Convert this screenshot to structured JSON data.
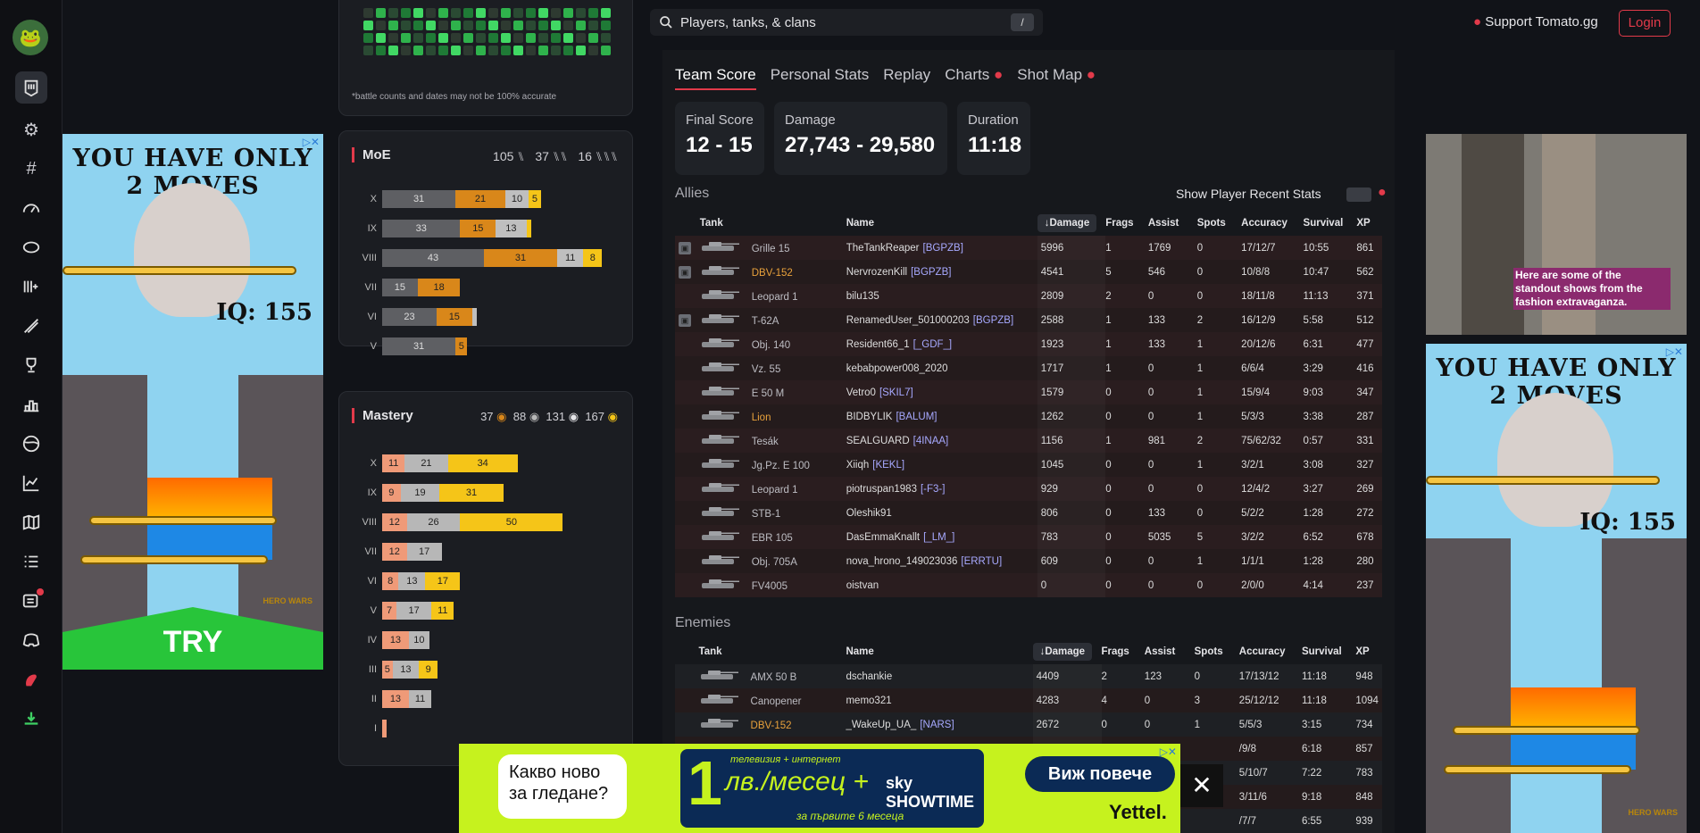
{
  "sidebar": {
    "icons": [
      "frog-logo-icon",
      "tank-nav-icon",
      "gear-icon",
      "hash-icon",
      "gauge-icon",
      "helmet-icon",
      "bars-plus-icon",
      "pen-icon",
      "trophy-icon",
      "podium-icon",
      "globe-icon",
      "line-chart-icon",
      "map-icon",
      "list-icon",
      "news-icon",
      "discord-icon",
      "tomato-icon",
      "download-icon"
    ]
  },
  "search": {
    "placeholder": "Players, tanks, & clans",
    "shortcut": "/"
  },
  "header": {
    "support_label": "Support Tomato.gg",
    "login_label": "Login"
  },
  "left_panel": {
    "footnote": "*battle counts and dates may not be 100% accurate",
    "moe": {
      "title": "MoE",
      "badges": [
        "105",
        "37",
        "16"
      ],
      "rows": [
        {
          "tier": "X",
          "values": [
            "31",
            "21",
            "10",
            "5"
          ]
        },
        {
          "tier": "IX",
          "values": [
            "33",
            "15",
            "13",
            ""
          ]
        },
        {
          "tier": "VIII",
          "values": [
            "43",
            "31",
            "11",
            "8"
          ]
        },
        {
          "tier": "VII",
          "values": [
            "15",
            "18"
          ]
        },
        {
          "tier": "VI",
          "values": [
            "23",
            "15",
            ""
          ]
        },
        {
          "tier": "V",
          "values": [
            "31",
            "5"
          ]
        }
      ]
    },
    "mastery": {
      "title": "Mastery",
      "badges": [
        "37",
        "88",
        "131",
        "167"
      ],
      "badge_icons": [
        "III",
        "II",
        "I",
        "M"
      ],
      "rows": [
        {
          "tier": "X",
          "values": [
            "11",
            "21",
            "34"
          ]
        },
        {
          "tier": "IX",
          "values": [
            "9",
            "19",
            "31"
          ]
        },
        {
          "tier": "VIII",
          "values": [
            "12",
            "26",
            "50"
          ]
        },
        {
          "tier": "VII",
          "values": [
            "12",
            "17"
          ]
        },
        {
          "tier": "VI",
          "values": [
            "8",
            "13",
            "17"
          ]
        },
        {
          "tier": "V",
          "values": [
            "7",
            "17",
            "11"
          ]
        },
        {
          "tier": "IV",
          "values": [
            "13",
            "10"
          ]
        },
        {
          "tier": "III",
          "values": [
            "5",
            "13",
            "9"
          ]
        },
        {
          "tier": "II",
          "values": [
            "13",
            "11"
          ]
        },
        {
          "tier": "I",
          "values": [
            ""
          ]
        }
      ]
    }
  },
  "tabs": [
    {
      "label": "Team Score",
      "active": true
    },
    {
      "label": "Personal Stats"
    },
    {
      "label": "Replay"
    },
    {
      "label": "Charts"
    },
    {
      "label": "Shot Map"
    }
  ],
  "summary": {
    "final_score_label": "Final Score",
    "final_score": "12 - 15",
    "damage_label": "Damage",
    "damage": "27,743 - 29,580",
    "duration_label": "Duration",
    "duration": "11:18"
  },
  "allies": {
    "title": "Allies",
    "show_recent_label": "Show Player Recent Stats",
    "columns": [
      "Tank",
      "Name",
      "Damage",
      "Frags",
      "Assist",
      "Spots",
      "Accuracy",
      "Survival",
      "XP"
    ],
    "rows": [
      {
        "platoon": true,
        "tank": "Grille 15",
        "name": "TheTankReaper",
        "clan": "[BGPZB]",
        "dmg": "5996",
        "frags": "1",
        "assist": "1769",
        "spots": "0",
        "acc": "17/12/7",
        "surv": "10:55",
        "xp": "861"
      },
      {
        "platoon": true,
        "tank": "DBV-152",
        "gold": true,
        "name": "NervrozenKill",
        "clan": "[BGPZB]",
        "dmg": "4541",
        "frags": "5",
        "assist": "546",
        "spots": "0",
        "acc": "10/8/8",
        "surv": "10:47",
        "xp": "562"
      },
      {
        "tank": "Leopard 1",
        "name": "bilu135",
        "clan": "",
        "dmg": "2809",
        "frags": "2",
        "assist": "0",
        "spots": "0",
        "acc": "18/11/8",
        "surv": "11:13",
        "xp": "371"
      },
      {
        "platoon": true,
        "tank": "T-62A",
        "name": "RenamedUser_501000203",
        "clan": "[BGPZB]",
        "dmg": "2588",
        "frags": "1",
        "assist": "133",
        "spots": "2",
        "acc": "16/12/9",
        "surv": "5:58",
        "xp": "512"
      },
      {
        "tank": "Obj. 140",
        "name": "Resident66_1",
        "clan": "[_GDF_]",
        "dmg": "1923",
        "frags": "1",
        "assist": "133",
        "spots": "1",
        "acc": "20/12/6",
        "surv": "6:31",
        "xp": "477"
      },
      {
        "tank": "Vz. 55",
        "name": "kebabpower008_2020",
        "clan": "",
        "dmg": "1717",
        "frags": "1",
        "assist": "0",
        "spots": "1",
        "acc": "6/6/4",
        "surv": "3:29",
        "xp": "416"
      },
      {
        "tank": "E 50 M",
        "name": "Vetro0",
        "clan": "[SKIL7]",
        "dmg": "1579",
        "frags": "0",
        "assist": "0",
        "spots": "1",
        "acc": "15/9/4",
        "surv": "9:03",
        "xp": "347"
      },
      {
        "tank": "Lion",
        "gold": true,
        "name": "BIDBYLIK",
        "clan": "[BALUM]",
        "dmg": "1262",
        "frags": "0",
        "assist": "0",
        "spots": "1",
        "acc": "5/3/3",
        "surv": "3:38",
        "xp": "287"
      },
      {
        "tank": "Tesák",
        "name": "SEALGUARD",
        "clan": "[4INAA]",
        "dmg": "1156",
        "frags": "1",
        "assist": "981",
        "spots": "2",
        "acc": "75/62/32",
        "surv": "0:57",
        "xp": "331"
      },
      {
        "tank": "Jg.Pz. E 100",
        "name": "Xiiqh",
        "clan": "[KEKL]",
        "dmg": "1045",
        "frags": "0",
        "assist": "0",
        "spots": "1",
        "acc": "3/2/1",
        "surv": "3:08",
        "xp": "327"
      },
      {
        "tank": "Leopard 1",
        "name": "piotruspan1983",
        "clan": "[-F3-]",
        "dmg": "929",
        "frags": "0",
        "assist": "0",
        "spots": "0",
        "acc": "12/4/2",
        "surv": "3:27",
        "xp": "269"
      },
      {
        "tank": "STB-1",
        "name": "Oleshik91",
        "clan": "",
        "dmg": "806",
        "frags": "0",
        "assist": "133",
        "spots": "0",
        "acc": "5/2/2",
        "surv": "1:28",
        "xp": "272"
      },
      {
        "tank": "EBR 105",
        "name": "DasEmmaKnallt",
        "clan": "[_LM_]",
        "dmg": "783",
        "frags": "0",
        "assist": "5035",
        "spots": "5",
        "acc": "3/2/2",
        "surv": "6:52",
        "xp": "678"
      },
      {
        "tank": "Obj. 705A",
        "name": "nova_hrono_149023036",
        "clan": "[ERRTU]",
        "dmg": "609",
        "frags": "0",
        "assist": "0",
        "spots": "1",
        "acc": "1/1/1",
        "surv": "1:28",
        "xp": "280"
      },
      {
        "tank": "FV4005",
        "name": "oistvan",
        "clan": "",
        "dmg": "0",
        "frags": "0",
        "assist": "0",
        "spots": "0",
        "acc": "2/0/0",
        "surv": "4:14",
        "xp": "237"
      }
    ]
  },
  "enemies": {
    "title": "Enemies",
    "columns": [
      "Tank",
      "Name",
      "Damage",
      "Frags",
      "Assist",
      "Spots",
      "Accuracy",
      "Survival",
      "XP"
    ],
    "rows": [
      {
        "tank": "AMX 50 B",
        "name": "dschankie",
        "clan": "",
        "dmg": "4409",
        "frags": "2",
        "assist": "123",
        "spots": "0",
        "acc": "17/13/12",
        "surv": "11:18",
        "xp": "948"
      },
      {
        "tank": "Canopener",
        "name": "memo321",
        "clan": "",
        "dmg": "4283",
        "frags": "4",
        "assist": "0",
        "spots": "3",
        "acc": "25/12/12",
        "surv": "11:18",
        "xp": "1094"
      },
      {
        "tank": "DBV-152",
        "gold": true,
        "name": "_WakeUp_UA_",
        "clan": "[NARS]",
        "dmg": "2672",
        "frags": "0",
        "assist": "0",
        "spots": "1",
        "acc": "5/5/3",
        "surv": "3:15",
        "xp": "734"
      },
      {
        "tank": "",
        "name": "",
        "clan": "",
        "dmg": "",
        "frags": "",
        "assist": "",
        "spots": "",
        "acc": "/9/8",
        "surv": "6:18",
        "xp": "857"
      },
      {
        "tank": "",
        "name": "",
        "clan": "",
        "dmg": "",
        "frags": "",
        "assist": "",
        "spots": "",
        "acc": "5/10/7",
        "surv": "7:22",
        "xp": "783"
      },
      {
        "tank": "",
        "name": "",
        "clan": "",
        "dmg": "",
        "frags": "",
        "assist": "",
        "spots": "",
        "acc": "3/11/6",
        "surv": "9:18",
        "xp": "848"
      },
      {
        "tank": "",
        "name": "",
        "clan": "",
        "dmg": "",
        "frags": "",
        "assist": "",
        "spots": "",
        "acc": "/7/7",
        "surv": "6:55",
        "xp": "939"
      }
    ]
  },
  "ads": {
    "left": {
      "headline": "YOU HAVE ONLY 2 MOVES",
      "iq": "IQ: 155",
      "cta": "TRY",
      "brand": "HERO WARS"
    },
    "right_video_caption": "Here are some of the standout shows from the fashion extravaganza.",
    "right": {
      "headline": "YOU HAVE ONLY 2 MOVES",
      "iq": "IQ: 155",
      "brand": "HERO WARS"
    },
    "bottom": {
      "bubble": "Какво ново за гледане?",
      "big_number": "1",
      "small_top": "телевизия + интернет",
      "price": "лв./месец +",
      "partner": "sky SHOWTIME",
      "small_bottom": "за първите 6 месеца",
      "cta": "Виж повече",
      "brand": "Yettel.",
      "close": "✕"
    }
  }
}
